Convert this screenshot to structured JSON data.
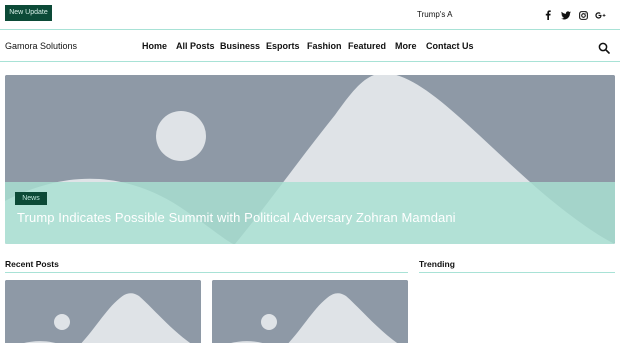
{
  "topbar": {
    "new_update_label": "New Update",
    "ticker_text": "Trump's A",
    "social": [
      {
        "icon": "facebook-icon"
      },
      {
        "icon": "twitter-icon"
      },
      {
        "icon": "instagram-icon"
      },
      {
        "icon": "google-plus-icon"
      }
    ]
  },
  "header": {
    "site_title": "Gamora Solutions",
    "nav": [
      {
        "label": "Home"
      },
      {
        "label": "All Posts"
      },
      {
        "label": "Business"
      },
      {
        "label": "Esports"
      },
      {
        "label": "Fashion"
      },
      {
        "label": "Featured"
      },
      {
        "label": "More"
      },
      {
        "label": "Contact Us"
      }
    ],
    "search_icon": "search-icon"
  },
  "hero": {
    "category": "News",
    "title": "Trump Indicates Possible Summit with Political Adversary Zohran Mamdani"
  },
  "sections": {
    "recent_posts": "Recent Posts",
    "trending": "Trending"
  },
  "colors": {
    "accent": "#0c4a37",
    "line": "#a8e2d6",
    "placeholder_bg": "#8e99a6",
    "placeholder_fg": "#dfe3e7"
  }
}
